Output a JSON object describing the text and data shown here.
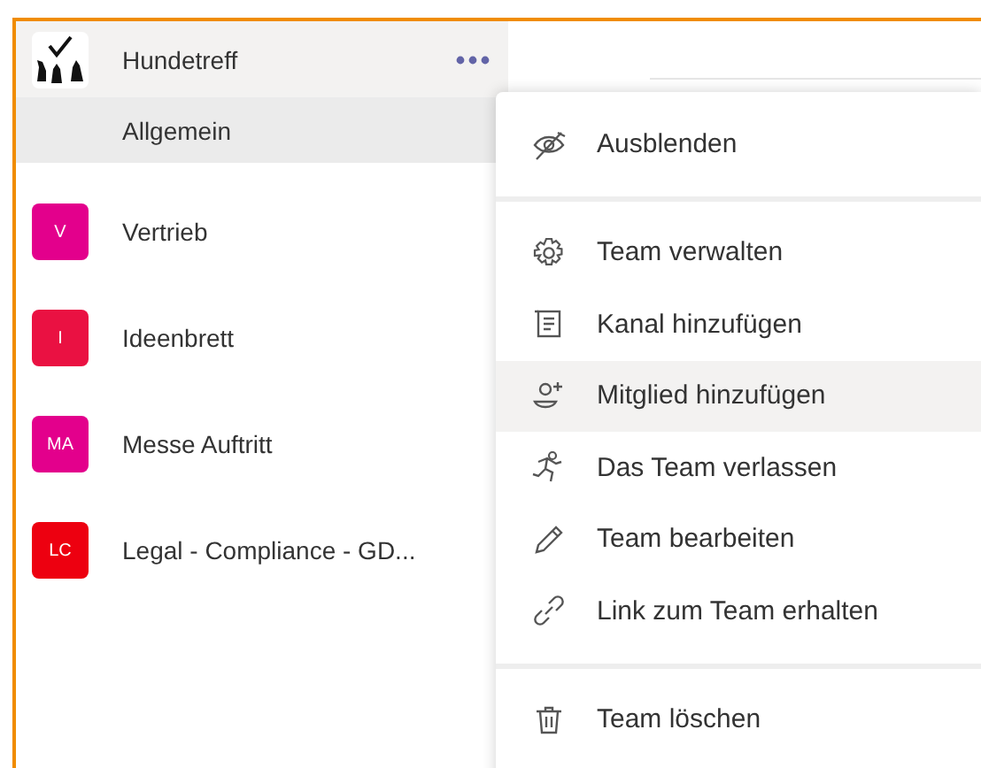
{
  "teams": [
    {
      "name": "Hundetreff",
      "avatar": {
        "kind": "logo"
      },
      "menu_open": true,
      "channels": [
        {
          "name": "Allgemein",
          "selected": true
        }
      ]
    },
    {
      "name": "Vertrieb",
      "avatar": {
        "kind": "initials",
        "initials": "V",
        "color": "#e3008c"
      }
    },
    {
      "name": "Ideenbrett",
      "avatar": {
        "kind": "initials",
        "initials": "I",
        "color": "#ea1142"
      }
    },
    {
      "name": "Messe Auftritt",
      "avatar": {
        "kind": "initials",
        "initials": "MA",
        "color": "#e3008c"
      }
    },
    {
      "name": "Legal - Compliance - GD...",
      "avatar": {
        "kind": "initials",
        "initials": "LC",
        "color": "#ed0010"
      }
    }
  ],
  "context_menu": {
    "groups": [
      [
        {
          "label": "Ausblenden",
          "kind": "hide",
          "hovered": false
        }
      ],
      [
        {
          "label": "Team verwalten",
          "kind": "gear",
          "hovered": false
        },
        {
          "label": "Kanal hinzufügen",
          "kind": "channel",
          "hovered": false
        },
        {
          "label": "Mitglied hinzufügen",
          "kind": "adduser",
          "hovered": true
        },
        {
          "label": "Das Team verlassen",
          "kind": "leave",
          "hovered": false
        },
        {
          "label": "Team bearbeiten",
          "kind": "pencil",
          "hovered": false
        },
        {
          "label": "Link zum Team erhalten",
          "kind": "link",
          "hovered": false
        }
      ],
      [
        {
          "label": "Team löschen",
          "kind": "trash",
          "hovered": false
        }
      ]
    ]
  }
}
